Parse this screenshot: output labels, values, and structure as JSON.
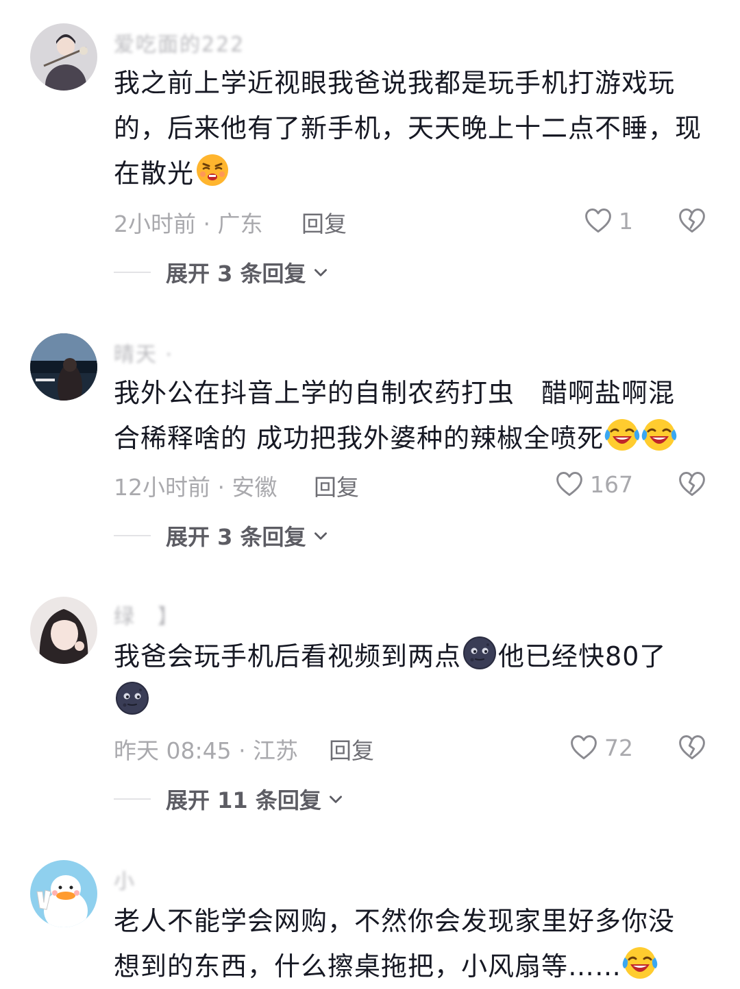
{
  "comments": [
    {
      "username": "爱吃面的222",
      "content": "我之前上学近视眼我爸说我都是玩手机打游戏玩的，后来他有了新手机，天天晚上十二点不睡，现在散光",
      "emoji": [
        "grimace-face-icon"
      ],
      "time_location": "2小时前 · 广东",
      "reply_label": "回复",
      "likes": "1",
      "expand_label": "展开 3 条回复"
    },
    {
      "username": "晴天 ·",
      "content_line1": "我外公在抖音上学的自制农药打虫　醋啊盐啊混",
      "content_line2": "合稀释啥的 成功把我外婆种的辣椒全喷死",
      "emoji": [
        "laugh-cry-face-icon",
        "laugh-cry-face-icon"
      ],
      "time_location": "12小时前 · 安徽",
      "reply_label": "回复",
      "likes": "167",
      "expand_label": "展开 3 条回复"
    },
    {
      "username": "绿　】",
      "content_part1": "我爸会玩手机后看视频到两点",
      "content_part2": "他已经快80了",
      "emoji": [
        "dark-moon-face-icon",
        "dark-moon-face-icon"
      ],
      "time_location": "昨天 08:45 · 江苏",
      "reply_label": "回复",
      "likes": "72",
      "expand_label": "展开 11 条回复"
    },
    {
      "username": "小",
      "content_line1": "老人不能学会网购，不然你会发现家里好多你没",
      "content_line2": "想到的东西，什么擦桌拖把，小风扇等……",
      "emoji": [
        "laugh-cry-face-icon"
      ]
    }
  ],
  "colors": {
    "text_primary": "#161823",
    "text_meta": "#a9a9ad",
    "text_reply": "#6e6e74",
    "icon_stroke": "#8a8a90"
  }
}
